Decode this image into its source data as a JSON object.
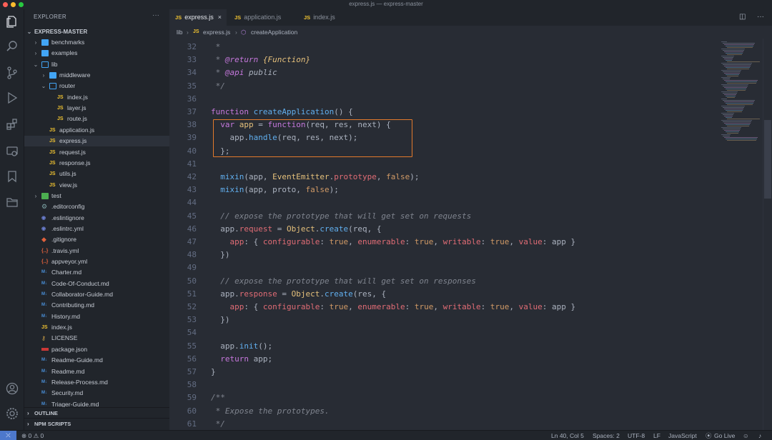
{
  "window": {
    "title": "express.js — express-master"
  },
  "activity_bar": {
    "items": [
      "files-icon",
      "search-icon",
      "source-control-icon",
      "run-debug-icon",
      "extensions-icon",
      "remote-explorer-icon",
      "bookmark-icon",
      "folder-icon",
      "account-icon",
      "settings-gear-icon"
    ]
  },
  "sidebar": {
    "header": "EXPLORER",
    "more": "···",
    "root": "EXPRESS-MASTER",
    "tree": [
      {
        "label": "benchmarks",
        "kind": "folder",
        "depth": 1,
        "open": false
      },
      {
        "label": "examples",
        "kind": "folder",
        "depth": 1,
        "open": false
      },
      {
        "label": "lib",
        "kind": "folder",
        "depth": 1,
        "open": true
      },
      {
        "label": "middleware",
        "kind": "folder",
        "depth": 2,
        "open": false
      },
      {
        "label": "router",
        "kind": "folder",
        "depth": 2,
        "open": true
      },
      {
        "label": "index.js",
        "kind": "js",
        "depth": 3
      },
      {
        "label": "layer.js",
        "kind": "js",
        "depth": 3
      },
      {
        "label": "route.js",
        "kind": "js",
        "depth": 3
      },
      {
        "label": "application.js",
        "kind": "js",
        "depth": 2
      },
      {
        "label": "express.js",
        "kind": "js",
        "depth": 2,
        "active": true
      },
      {
        "label": "request.js",
        "kind": "js",
        "depth": 2
      },
      {
        "label": "response.js",
        "kind": "js",
        "depth": 2
      },
      {
        "label": "utils.js",
        "kind": "js",
        "depth": 2
      },
      {
        "label": "view.js",
        "kind": "js",
        "depth": 2
      },
      {
        "label": "test",
        "kind": "test",
        "depth": 1,
        "open": false
      },
      {
        "label": ".editorconfig",
        "kind": "gear",
        "depth": 1
      },
      {
        "label": ".eslintignore",
        "kind": "lint",
        "depth": 1
      },
      {
        "label": ".eslintrc.yml",
        "kind": "lint",
        "depth": 1
      },
      {
        "label": ".gitignore",
        "kind": "git",
        "depth": 1
      },
      {
        "label": ".travis.yml",
        "kind": "yml",
        "depth": 1
      },
      {
        "label": "appveyor.yml",
        "kind": "yml",
        "depth": 1
      },
      {
        "label": "Charter.md",
        "kind": "md",
        "depth": 1
      },
      {
        "label": "Code-Of-Conduct.md",
        "kind": "md",
        "depth": 1
      },
      {
        "label": "Collaborator-Guide.md",
        "kind": "md",
        "depth": 1
      },
      {
        "label": "Contributing.md",
        "kind": "md",
        "depth": 1
      },
      {
        "label": "History.md",
        "kind": "md",
        "depth": 1
      },
      {
        "label": "index.js",
        "kind": "js",
        "depth": 1
      },
      {
        "label": "LICENSE",
        "kind": "lic",
        "depth": 1
      },
      {
        "label": "package.json",
        "kind": "npm",
        "depth": 1
      },
      {
        "label": "Readme-Guide.md",
        "kind": "md",
        "depth": 1
      },
      {
        "label": "Readme.md",
        "kind": "md",
        "depth": 1
      },
      {
        "label": "Release-Process.md",
        "kind": "md",
        "depth": 1
      },
      {
        "label": "Security.md",
        "kind": "md",
        "depth": 1
      },
      {
        "label": "Triager-Guide.md",
        "kind": "md",
        "depth": 1
      }
    ],
    "sections": [
      "OUTLINE",
      "NPM SCRIPTS"
    ]
  },
  "tabs": [
    {
      "label": "express.js",
      "active": true,
      "close": "×"
    },
    {
      "label": "application.js",
      "active": false
    },
    {
      "label": "index.js",
      "active": false
    }
  ],
  "breadcrumb": {
    "folder": "lib",
    "sep": "›",
    "file": "express.js",
    "symbol": "createApplication"
  },
  "editor": {
    "lines": [
      {
        "n": "32",
        "tokens": [
          [
            "cm",
            " *"
          ]
        ]
      },
      {
        "n": "33",
        "tokens": [
          [
            "cm",
            " * "
          ],
          [
            "tag",
            "@return"
          ],
          [
            "cm",
            " "
          ],
          [
            "type",
            "{Function}"
          ]
        ]
      },
      {
        "n": "34",
        "tokens": [
          [
            "cm",
            " * "
          ],
          [
            "tag",
            "@api"
          ],
          [
            "cm",
            " "
          ],
          [
            "plit",
            "public"
          ]
        ]
      },
      {
        "n": "35",
        "tokens": [
          [
            "cm",
            " */"
          ]
        ]
      },
      {
        "n": "36",
        "tokens": []
      },
      {
        "n": "37",
        "tokens": [
          [
            "kw",
            "function"
          ],
          [
            "pl",
            " "
          ],
          [
            "fn",
            "createApplication"
          ],
          [
            "pl",
            "() {"
          ]
        ]
      },
      {
        "n": "38",
        "tokens": [
          [
            "pl",
            "  "
          ],
          [
            "kw",
            "var"
          ],
          [
            "pl",
            " "
          ],
          [
            "var",
            "app"
          ],
          [
            "pl",
            " = "
          ],
          [
            "kw",
            "function"
          ],
          [
            "pl",
            "(req, res, next) {"
          ]
        ]
      },
      {
        "n": "39",
        "tokens": [
          [
            "pl",
            "    app."
          ],
          [
            "fn",
            "handle"
          ],
          [
            "pl",
            "(req, res, next);"
          ]
        ]
      },
      {
        "n": "40",
        "tokens": [
          [
            "pl",
            "  };"
          ]
        ]
      },
      {
        "n": "41",
        "tokens": []
      },
      {
        "n": "42",
        "tokens": [
          [
            "pl",
            "  "
          ],
          [
            "fn",
            "mixin"
          ],
          [
            "pl",
            "(app, "
          ],
          [
            "var",
            "EventEmitter"
          ],
          [
            "pl",
            "."
          ],
          [
            "prop",
            "prototype"
          ],
          [
            "pl",
            ", "
          ],
          [
            "bool",
            "false"
          ],
          [
            "pl",
            ");"
          ]
        ]
      },
      {
        "n": "43",
        "tokens": [
          [
            "pl",
            "  "
          ],
          [
            "fn",
            "mixin"
          ],
          [
            "pl",
            "(app, proto, "
          ],
          [
            "bool",
            "false"
          ],
          [
            "pl",
            ");"
          ]
        ]
      },
      {
        "n": "44",
        "tokens": []
      },
      {
        "n": "45",
        "tokens": [
          [
            "pl",
            "  "
          ],
          [
            "cm",
            "// expose the prototype that will get set on requests"
          ]
        ]
      },
      {
        "n": "46",
        "tokens": [
          [
            "pl",
            "  app."
          ],
          [
            "prop",
            "request"
          ],
          [
            "pl",
            " = "
          ],
          [
            "var",
            "Object"
          ],
          [
            "pl",
            "."
          ],
          [
            "fn",
            "create"
          ],
          [
            "pl",
            "(req, {"
          ]
        ]
      },
      {
        "n": "47",
        "tokens": [
          [
            "pl",
            "    "
          ],
          [
            "prop",
            "app"
          ],
          [
            "pl",
            ": { "
          ],
          [
            "prop",
            "configurable"
          ],
          [
            "pl",
            ": "
          ],
          [
            "bool",
            "true"
          ],
          [
            "pl",
            ", "
          ],
          [
            "prop",
            "enumerable"
          ],
          [
            "pl",
            ": "
          ],
          [
            "bool",
            "true"
          ],
          [
            "pl",
            ", "
          ],
          [
            "prop",
            "writable"
          ],
          [
            "pl",
            ": "
          ],
          [
            "bool",
            "true"
          ],
          [
            "pl",
            ", "
          ],
          [
            "prop",
            "value"
          ],
          [
            "pl",
            ": app }"
          ]
        ]
      },
      {
        "n": "48",
        "tokens": [
          [
            "pl",
            "  })"
          ]
        ]
      },
      {
        "n": "49",
        "tokens": []
      },
      {
        "n": "50",
        "tokens": [
          [
            "pl",
            "  "
          ],
          [
            "cm",
            "// expose the prototype that will get set on responses"
          ]
        ]
      },
      {
        "n": "51",
        "tokens": [
          [
            "pl",
            "  app."
          ],
          [
            "prop",
            "response"
          ],
          [
            "pl",
            " = "
          ],
          [
            "var",
            "Object"
          ],
          [
            "pl",
            "."
          ],
          [
            "fn",
            "create"
          ],
          [
            "pl",
            "(res, {"
          ]
        ]
      },
      {
        "n": "52",
        "tokens": [
          [
            "pl",
            "    "
          ],
          [
            "prop",
            "app"
          ],
          [
            "pl",
            ": { "
          ],
          [
            "prop",
            "configurable"
          ],
          [
            "pl",
            ": "
          ],
          [
            "bool",
            "true"
          ],
          [
            "pl",
            ", "
          ],
          [
            "prop",
            "enumerable"
          ],
          [
            "pl",
            ": "
          ],
          [
            "bool",
            "true"
          ],
          [
            "pl",
            ", "
          ],
          [
            "prop",
            "writable"
          ],
          [
            "pl",
            ": "
          ],
          [
            "bool",
            "true"
          ],
          [
            "pl",
            ", "
          ],
          [
            "prop",
            "value"
          ],
          [
            "pl",
            ": app }"
          ]
        ]
      },
      {
        "n": "53",
        "tokens": [
          [
            "pl",
            "  })"
          ]
        ]
      },
      {
        "n": "54",
        "tokens": []
      },
      {
        "n": "55",
        "tokens": [
          [
            "pl",
            "  app."
          ],
          [
            "fn",
            "init"
          ],
          [
            "pl",
            "();"
          ]
        ]
      },
      {
        "n": "56",
        "tokens": [
          [
            "pl",
            "  "
          ],
          [
            "kw",
            "return"
          ],
          [
            "pl",
            " app;"
          ]
        ]
      },
      {
        "n": "57",
        "tokens": [
          [
            "pl",
            "}"
          ]
        ]
      },
      {
        "n": "58",
        "tokens": []
      },
      {
        "n": "59",
        "tokens": [
          [
            "cm",
            "/**"
          ]
        ]
      },
      {
        "n": "60",
        "tokens": [
          [
            "cm",
            " * Expose the prototypes."
          ]
        ]
      },
      {
        "n": "61",
        "tokens": [
          [
            "cm",
            " */"
          ]
        ]
      }
    ]
  },
  "statusbar": {
    "remote": "⤫",
    "problems": "⊗ 0 ⚠ 0",
    "cursor": "Ln 40, Col 5",
    "spaces": "Spaces: 2",
    "encoding": "UTF-8",
    "eol": "LF",
    "language": "JavaScript",
    "golive": "Go Live"
  },
  "colors": {
    "accent": "#4d78cc",
    "highlight_box": "#e37a2c",
    "editor_bg": "#282c34",
    "sidebar_bg": "#21252b"
  }
}
